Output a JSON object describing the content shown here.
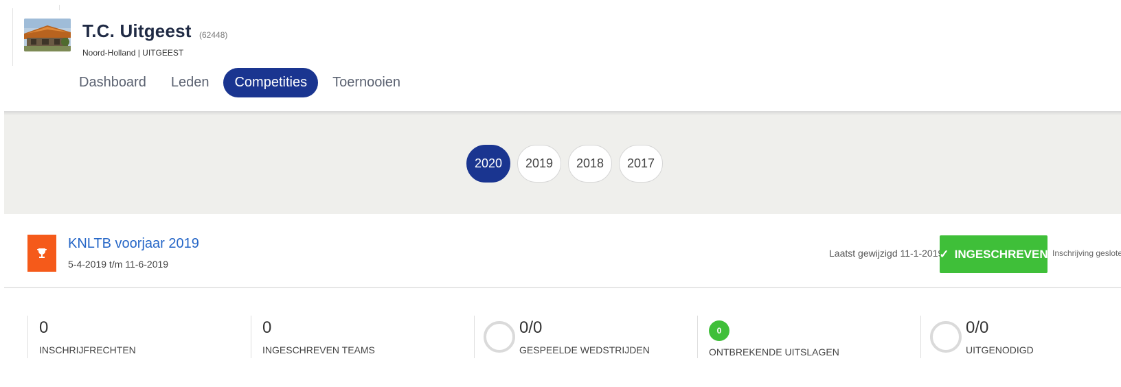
{
  "club": {
    "name": "T.C. Uitgeest",
    "code": "(62448)",
    "location": "Noord-Holland | UITGEEST"
  },
  "nav": {
    "tabs": [
      {
        "label": "Dashboard",
        "active": false
      },
      {
        "label": "Leden",
        "active": false
      },
      {
        "label": "Competities",
        "active": true
      },
      {
        "label": "Toernooien",
        "active": false
      }
    ]
  },
  "years": [
    {
      "label": "2020",
      "active": true
    },
    {
      "label": "2019",
      "active": false
    },
    {
      "label": "2018",
      "active": false
    },
    {
      "label": "2017",
      "active": false
    }
  ],
  "competition": {
    "icon": "trophy-icon",
    "title": "KNLTB voorjaar 2019",
    "dates": "5-4-2019 t/m 11-6-2019",
    "last_modified": "Laatst gewijzigd 11-1-2019",
    "status_label": "INGESCHREVEN",
    "status_icon": "check-icon",
    "closed_note": "Inschrijving gesloten"
  },
  "stats": [
    {
      "value": "0",
      "label": "INSCHRIJFRECHTEN",
      "indicator": "none"
    },
    {
      "value": "0",
      "label": "INGESCHREVEN TEAMS",
      "indicator": "none"
    },
    {
      "value": "0/0",
      "label": "GESPEELDE WEDSTRIJDEN",
      "indicator": "ring"
    },
    {
      "value": "0",
      "label": "ONTBREKENDE UITSLAGEN",
      "indicator": "badge"
    },
    {
      "value": "0/0",
      "label": "UITGENODIGD",
      "indicator": "ring"
    }
  ],
  "colors": {
    "primary": "#1a3590",
    "link": "#2566c7",
    "success": "#3fbf39",
    "trophy_bg": "#f55a1a",
    "band_bg": "#efefec"
  }
}
